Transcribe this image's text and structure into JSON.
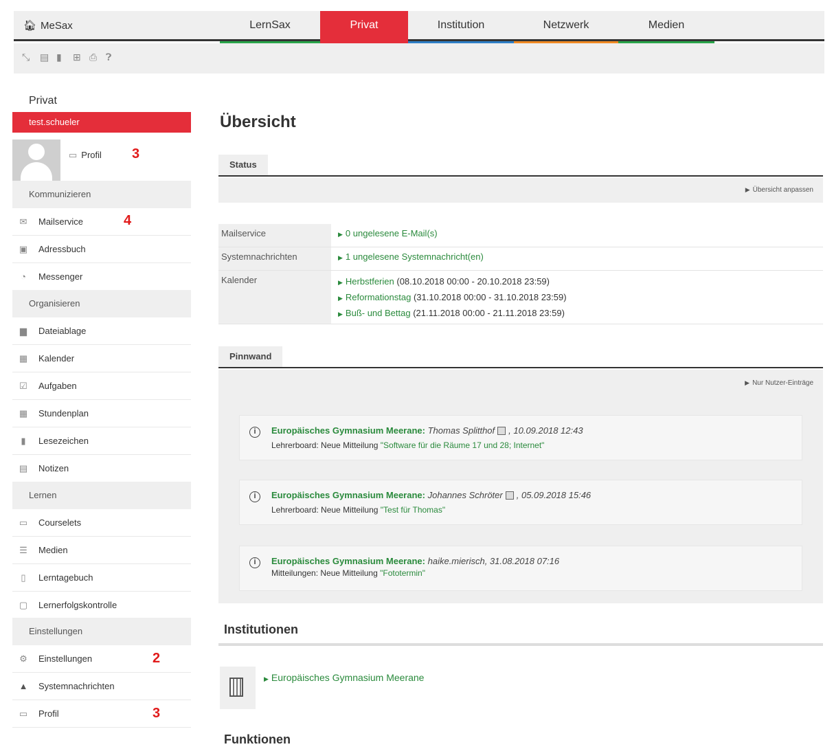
{
  "topnav": {
    "home_label": "MeSax",
    "tabs": [
      {
        "label": "LernSax",
        "color": "#2aa54a"
      },
      {
        "label": "Privat",
        "color": "#e42e3a"
      },
      {
        "label": "Institution",
        "color": "#2f7fc6"
      },
      {
        "label": "Netzwerk",
        "color": "#f08a24"
      },
      {
        "label": "Medien",
        "color": "#2aa54a"
      }
    ]
  },
  "toolbar": {
    "icons": [
      "path-icon",
      "note-icon",
      "bookmark-icon",
      "export-icon",
      "print-icon",
      "help-icon"
    ]
  },
  "sidebar": {
    "title": "Privat",
    "user": "test.schueler",
    "profile_link": "Profil",
    "annotations": {
      "profile": "3",
      "mail": "4",
      "settings": "2",
      "profile_bottom": "3"
    },
    "sections": {
      "communicate": "Kommunizieren",
      "organize": "Organisieren",
      "learn": "Lernen",
      "settings": "Einstellungen"
    },
    "items": {
      "mail": "Mailservice",
      "addressbook": "Adressbuch",
      "messenger": "Messenger",
      "files": "Dateiablage",
      "calendar": "Kalender",
      "tasks": "Aufgaben",
      "timetable": "Stundenplan",
      "bookmarks": "Lesezeichen",
      "notes": "Notizen",
      "courselets": "Courselets",
      "media": "Medien",
      "diary": "Lerntagebuch",
      "assessment": "Lernerfolgskontrolle",
      "settings": "Einstellungen",
      "sysmessages": "Systemnachrichten",
      "profile": "Profil"
    }
  },
  "main": {
    "title": "Übersicht",
    "status": {
      "tab_label": "Status",
      "adjust_link": "Übersicht anpassen",
      "rows": {
        "mail": {
          "key": "Mailservice",
          "value": "0 ungelesene E-Mail(s)"
        },
        "sys": {
          "key": "Systemnachrichten",
          "value": "1 ungelesene Systemnachricht(en)"
        },
        "cal": {
          "key": "Kalender",
          "events": [
            {
              "name": "Herbstferien",
              "time": "(08.10.2018 00:00 - 20.10.2018 23:59)"
            },
            {
              "name": "Reformationstag",
              "time": "(31.10.2018 00:00 - 31.10.2018 23:59)"
            },
            {
              "name": "Buß- und Bettag",
              "time": "(21.11.2018 00:00 - 21.11.2018 23:59)"
            }
          ]
        }
      }
    },
    "pinnwand": {
      "tab_label": "Pinnwand",
      "filter_link": "Nur Nutzer-Einträge",
      "entries": [
        {
          "org": "Europäisches Gymnasium Meerane:",
          "author": "Thomas Splitthof",
          "time": ", 10.09.2018 12:43",
          "board": "Lehrerboard: Neue Mitteilung",
          "message": "\"Software für die Räume 17 und 28; Internet\""
        },
        {
          "org": "Europäisches Gymnasium Meerane:",
          "author": "Johannes Schröter",
          "time": ", 05.09.2018 15:46",
          "board": "Lehrerboard: Neue Mitteilung",
          "message": "\"Test für Thomas\""
        },
        {
          "org": "Europäisches Gymnasium Meerane:",
          "author": "haike.mierisch",
          "time": ", 31.08.2018 07:16",
          "board": "Mitteilungen: Neue Mitteilung",
          "message": "\"Fototermin\""
        }
      ]
    },
    "institutions": {
      "title": "Institutionen",
      "link": "Europäisches Gymnasium Meerane"
    },
    "functions": {
      "title": "Funktionen"
    }
  }
}
